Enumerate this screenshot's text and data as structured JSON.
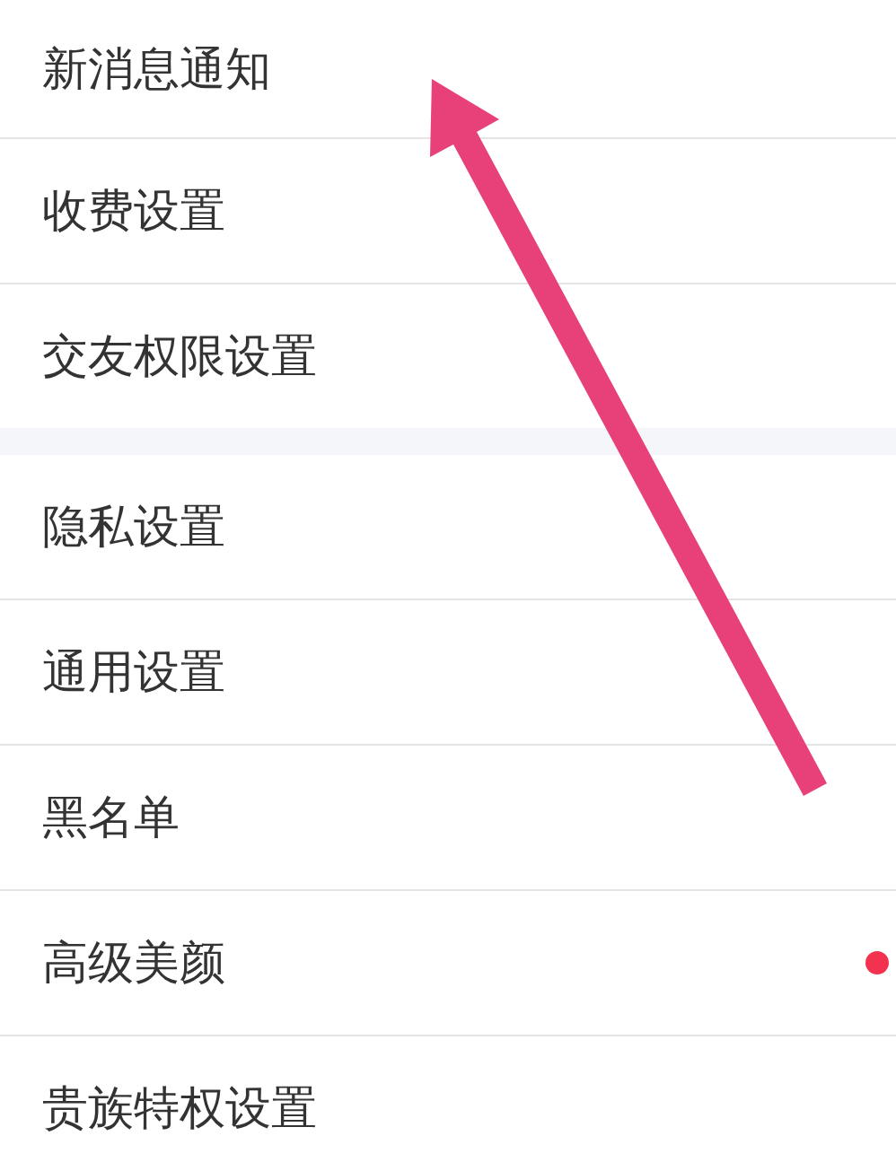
{
  "sections": [
    {
      "items": [
        {
          "label": "新消息通知",
          "badge": false
        },
        {
          "label": "收费设置",
          "badge": false
        },
        {
          "label": "交友权限设置",
          "badge": false
        }
      ]
    },
    {
      "items": [
        {
          "label": "隐私设置",
          "badge": false
        },
        {
          "label": "通用设置",
          "badge": false
        },
        {
          "label": "黑名单",
          "badge": false
        },
        {
          "label": "高级美颜",
          "badge": true
        },
        {
          "label": "贵族特权设置",
          "badge": false
        }
      ]
    }
  ]
}
